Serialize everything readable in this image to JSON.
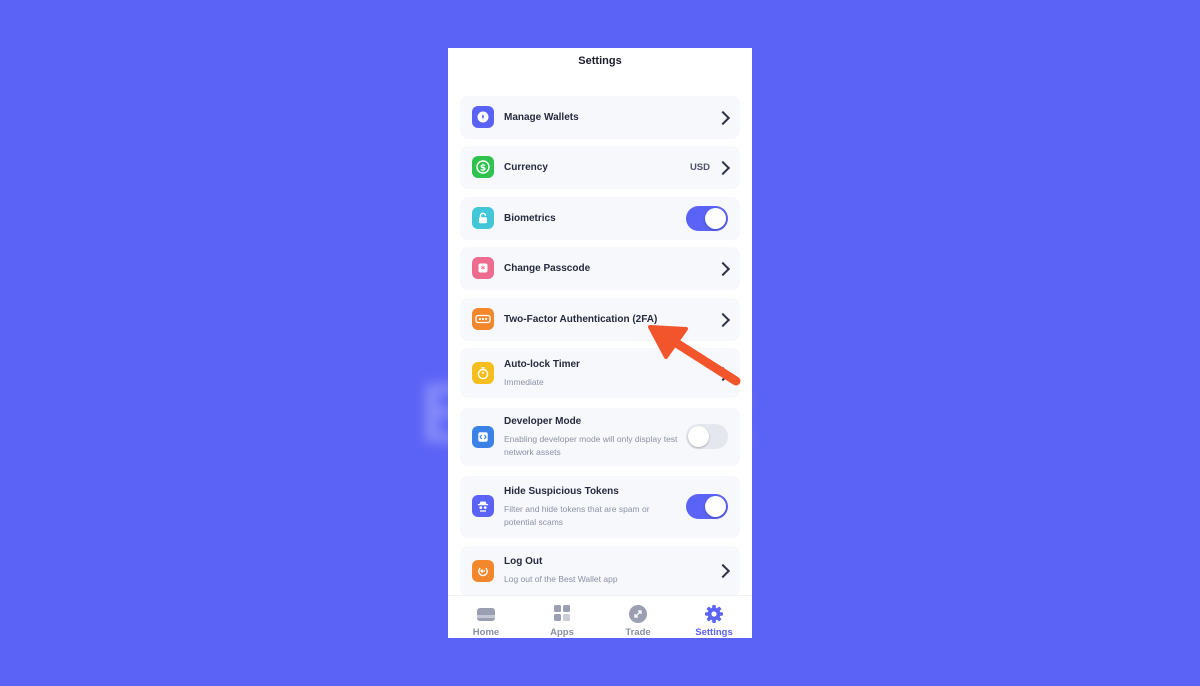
{
  "background_color": "#5b62f6",
  "accent_color": "#5b62f6",
  "header": {
    "title": "Settings"
  },
  "settings": {
    "manage_wallets": {
      "label": "Manage Wallets",
      "icon": "wallet-icon",
      "color": "#5b62f6"
    },
    "currency": {
      "label": "Currency",
      "value": "USD",
      "icon": "dollar-icon",
      "color": "#2fc24f"
    },
    "biometrics": {
      "label": "Biometrics",
      "icon": "lock-icon",
      "color": "#42c7d8",
      "enabled": true
    },
    "change_passcode": {
      "label": "Change Passcode",
      "icon": "asterisk-icon",
      "color": "#ec6b8e"
    },
    "two_factor": {
      "label": "Two-Factor Authentication (2FA)",
      "icon": "password-dots-icon",
      "color": "#f2872c"
    },
    "auto_lock": {
      "label": "Auto-lock Timer",
      "sub": "Immediate",
      "icon": "timer-icon",
      "color": "#f6be1d"
    },
    "developer_mode": {
      "label": "Developer Mode",
      "sub": "Enabling developer mode will only display test network assets",
      "icon": "code-icon",
      "color": "#3b82e6",
      "enabled": false
    },
    "hide_suspicious": {
      "label": "Hide Suspicious Tokens",
      "sub": "Filter and hide tokens that are spam or potential scams",
      "icon": "spy-icon",
      "color": "#5b62f6",
      "enabled": true
    },
    "log_out": {
      "label": "Log Out",
      "sub": "Log out of the Best Wallet app",
      "icon": "logout-icon",
      "color": "#f2872c"
    }
  },
  "tabs": [
    {
      "label": "Home",
      "icon": "wallet-card-icon"
    },
    {
      "label": "Apps",
      "icon": "grid-icon"
    },
    {
      "label": "Trade",
      "icon": "swap-icon"
    },
    {
      "label": "Settings",
      "icon": "gear-icon",
      "active": true
    }
  ],
  "annotation": {
    "icon": "red-arrow-icon",
    "color": "#f2552c"
  }
}
